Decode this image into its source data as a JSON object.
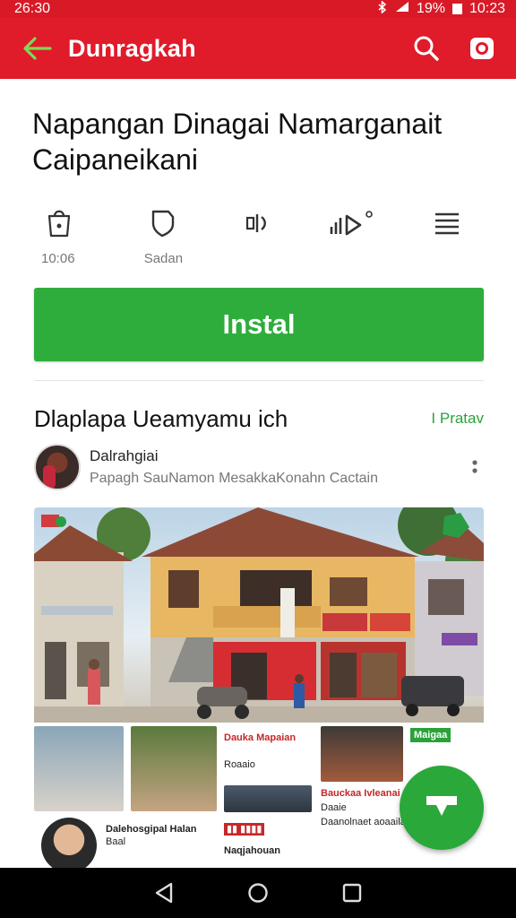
{
  "status_bar": {
    "time": "26:30",
    "battery": "19%",
    "clock": "10:23"
  },
  "app_bar": {
    "title": "Dunragkah",
    "back_icon": "arrow-left-icon",
    "search_icon": "search-icon",
    "camera_icon": "camera-icon"
  },
  "app": {
    "title": "Napangan Dinagai Namarganait Caipaneikani"
  },
  "stats": [
    {
      "icon": "bag-icon",
      "label": "10:06"
    },
    {
      "icon": "shield-icon",
      "label": "Sadan"
    },
    {
      "icon": "volume-icon",
      "label": ""
    },
    {
      "icon": "signal-play-icon",
      "label": ""
    },
    {
      "icon": "menu-icon",
      "label": ""
    }
  ],
  "install_label": "Instal",
  "section": {
    "heading": "Dlaplapa Ueamyamu ich",
    "link": "I Pratav"
  },
  "author": {
    "name": "Dalrahgiai",
    "subtitle": "Papagh SauNamon MesakkaKonahn Cactain"
  },
  "tiles": {
    "t1_title": "Dauka Mapaian",
    "t1_sub": "Roaaio",
    "t1_btn": "Maigaa",
    "t2_title": "Bauckaa Ivleanai",
    "t2_sub": "Daaie",
    "t3_title": "Dalehosgipal Halan",
    "t3_sub": "Baal",
    "t4_title": "Naqjahouan",
    "t5_title": "Daanolnaet aoaaila"
  },
  "colors": {
    "appbar": "#e01b2a",
    "statusbar": "#d81a27",
    "install": "#2fad3c",
    "accent_green": "#2aa23a"
  }
}
